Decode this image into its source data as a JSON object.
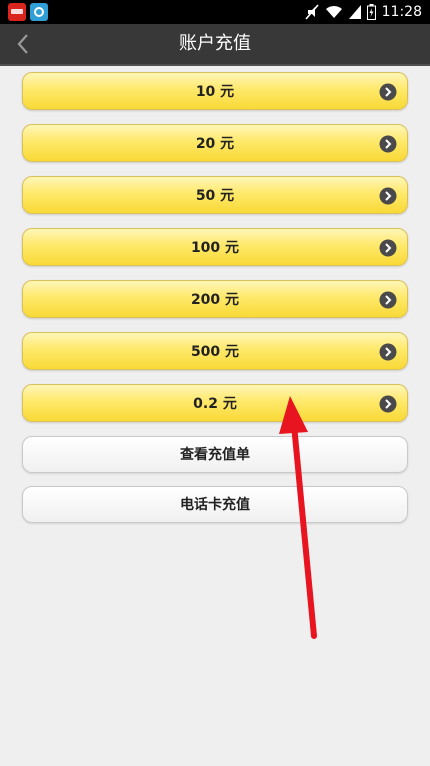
{
  "status_bar": {
    "time": "11:28",
    "icons": [
      "app-red-icon",
      "app-teal-icon",
      "mute-icon",
      "wifi-icon",
      "signal-icon",
      "battery-icon"
    ]
  },
  "header": {
    "title": "账户充值",
    "back_icon": "chevron-left-icon"
  },
  "amounts": [
    {
      "label": "10 元"
    },
    {
      "label": "20 元"
    },
    {
      "label": "50 元"
    },
    {
      "label": "100 元"
    },
    {
      "label": "200 元"
    },
    {
      "label": "500 元"
    },
    {
      "label": "0.2 元"
    }
  ],
  "actions": {
    "view_orders": "查看充值单",
    "phone_card": "电话卡充值"
  },
  "colors": {
    "button_yellow": "#ffe96b",
    "title_bar": "#383838",
    "annotation_arrow": "#e8141f"
  }
}
